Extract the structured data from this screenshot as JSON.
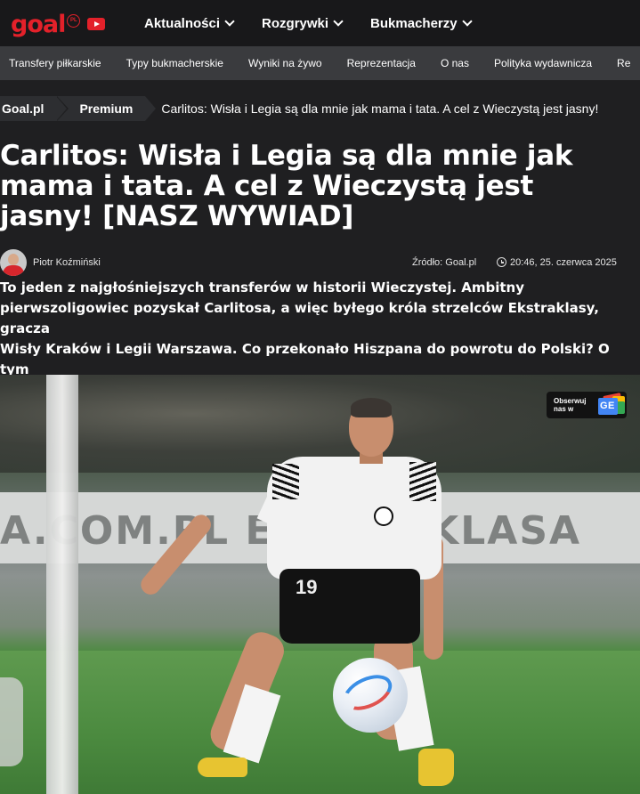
{
  "header": {
    "logo_text": "goal",
    "logo_badge": "PL",
    "nav": [
      {
        "label": "Aktualności"
      },
      {
        "label": "Rozgrywki"
      },
      {
        "label": "Bukmacherzy"
      }
    ]
  },
  "subnav": {
    "items": [
      {
        "label": "Transfery piłkarskie"
      },
      {
        "label": "Typy bukmacherskie"
      },
      {
        "label": "Wyniki na żywo"
      },
      {
        "label": "Reprezentacja"
      },
      {
        "label": "O nas"
      },
      {
        "label": "Polityka wydawnicza"
      },
      {
        "label": "Re"
      }
    ]
  },
  "breadcrumb": {
    "home": "Goal.pl",
    "section": "Premium",
    "current": "Carlitos: Wisła i Legia są dla mnie jak mama i tata. A cel z Wieczystą jest jasny!"
  },
  "article": {
    "title": "Carlitos: Wisła i Legia są dla mnie jak mama i tata. A cel z Wieczystą jest jasny! [NASZ WYWIAD]",
    "author": "Piotr Koźmiński",
    "source": "Źródło: Goal.pl",
    "datetime": "20:46, 25. czerwca 2025",
    "lead": "To jeden z najgłośniejszych transferów w historii Wieczystej. Ambitny\npierwszoligowiec pozyskał Carlitosa, a więc byłego króla strzelców Ekstraklasy, gracza\nWisły Kraków i Legii Warszawa. Co przekonało Hiszpana do powrotu do Polski? O tym\nCarlitos opowiedział w jedynym wywiadzie, udzielonym goal.pl"
  },
  "follow_badge": {
    "text": "Obserwuj nas w",
    "icon_label": "GE"
  },
  "photo": {
    "shirt_number": "19",
    "board_text": "A.COM.PL  EKSTRAKLASA"
  },
  "colors": {
    "brand": "#e3212a",
    "page_bg": "#1f1f21",
    "subnav_bg": "#3a3b3e"
  }
}
